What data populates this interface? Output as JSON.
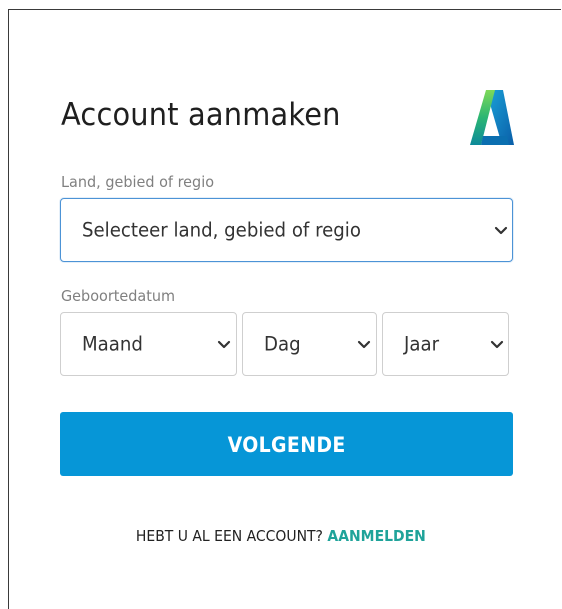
{
  "page": {
    "title": "Account aanmaken"
  },
  "brand": {
    "logo_icon": "autodesk-logo-icon",
    "colors": {
      "top": "#5cc87c",
      "middle": "#1a9fd0",
      "bottom": "#0b5fa5"
    }
  },
  "region": {
    "label": "Land, gebied of regio",
    "value": "Selecteer land, gebied of regio",
    "icon": "chevron-down-icon"
  },
  "birthdate": {
    "label": "Geboortedatum",
    "month": "Maand",
    "day": "Dag",
    "year": "Jaar"
  },
  "actions": {
    "next_label": "VOLGENDE",
    "next_color": "#0696d7"
  },
  "footer": {
    "prompt": "HEBT U AL EEN ACCOUNT?",
    "signin_link": "AANMELDEN",
    "link_color": "#1fa39a"
  }
}
